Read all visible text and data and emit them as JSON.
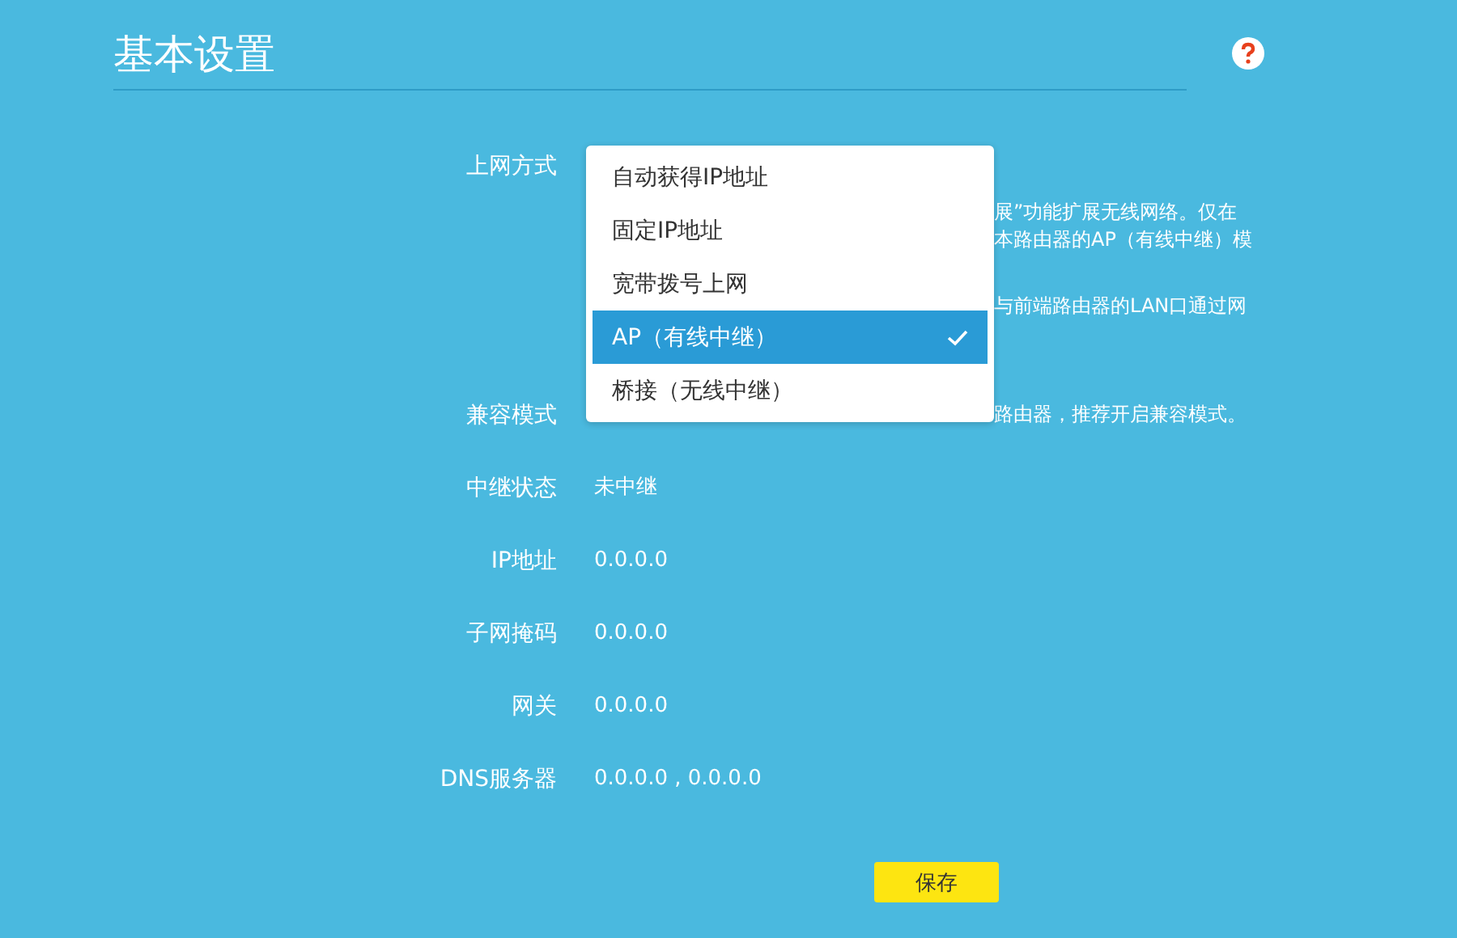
{
  "page": {
    "title": "基本设置"
  },
  "fields": [
    {
      "kind": "select",
      "label": "上网方式",
      "notes": [
        "展”功能扩展无线网络。仅在",
        "本路由器的AP（有线中继）模",
        "与前端路由器的LAN口通过网"
      ]
    },
    {
      "kind": "note",
      "label": "兼容模式",
      "notes": [
        "路由器，推荐开启兼容模式。"
      ]
    },
    {
      "kind": "value",
      "label": "中继状态",
      "value": "未中继"
    },
    {
      "kind": "value",
      "label": "IP地址",
      "value": "0.0.0.0"
    },
    {
      "kind": "value",
      "label": "子网掩码",
      "value": "0.0.0.0"
    },
    {
      "kind": "value",
      "label": "网关",
      "value": "0.0.0.0"
    },
    {
      "kind": "value",
      "label": "DNS服务器",
      "value": "0.0.0.0 , 0.0.0.0"
    }
  ],
  "dropdown": {
    "options": [
      {
        "label": "自动获得IP地址",
        "selected": false
      },
      {
        "label": "固定IP地址",
        "selected": false
      },
      {
        "label": "宽带拨号上网",
        "selected": false
      },
      {
        "label": "AP（有线中继）",
        "selected": true
      },
      {
        "label": "桥接（无线中继）",
        "selected": false
      }
    ]
  },
  "save_button": "保存"
}
